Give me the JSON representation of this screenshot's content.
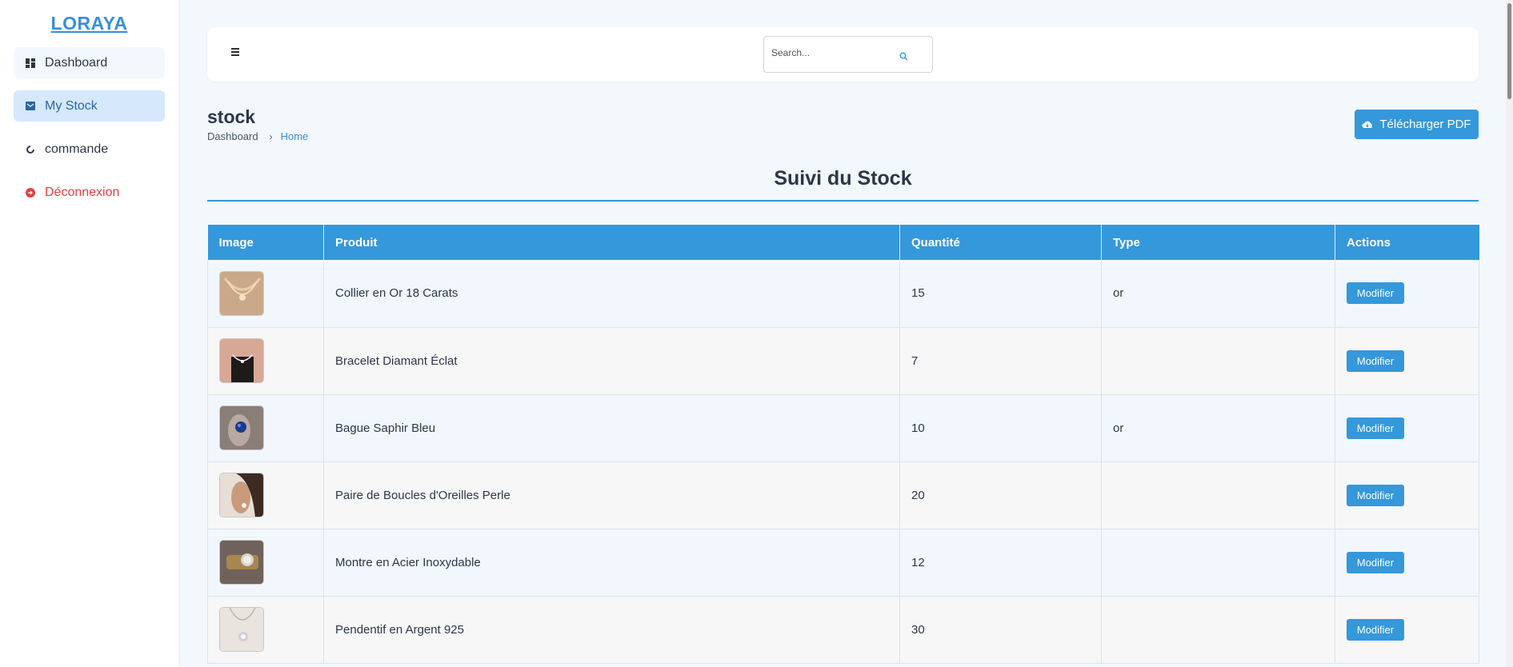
{
  "brand": "LORAYA",
  "sidebar": {
    "items": [
      {
        "label": "Dashboard",
        "icon": "dashboard-icon"
      },
      {
        "label": "My Stock",
        "icon": "stock-icon"
      },
      {
        "label": "commande",
        "icon": "loader-icon"
      },
      {
        "label": "Déconnexion",
        "icon": "logout-icon"
      }
    ]
  },
  "topbar": {
    "search_placeholder": "Search..."
  },
  "page": {
    "title": "stock",
    "breadcrumb": [
      "Dashboard",
      "Home"
    ],
    "pdf_button": "Télécharger PDF",
    "section_title": "Suivi du Stock"
  },
  "table": {
    "headers": [
      "Image",
      "Produit",
      "Quantité",
      "Type",
      "Actions"
    ],
    "rows": [
      {
        "product": "Collier en Or 18 Carats",
        "quantity": "15",
        "type": "or",
        "action": "Modifier"
      },
      {
        "product": "Bracelet Diamant Éclat",
        "quantity": "7",
        "type": "",
        "action": "Modifier"
      },
      {
        "product": "Bague Saphir Bleu",
        "quantity": "10",
        "type": "or",
        "action": "Modifier"
      },
      {
        "product": "Paire de Boucles d'Oreilles Perle",
        "quantity": "20",
        "type": "",
        "action": "Modifier"
      },
      {
        "product": "Montre en Acier Inoxydable",
        "quantity": "12",
        "type": "",
        "action": "Modifier"
      },
      {
        "product": "Pendentif en Argent 925",
        "quantity": "30",
        "type": "",
        "action": "Modifier"
      }
    ]
  },
  "colors": {
    "accent": "#3498db",
    "danger": "#e53e3e",
    "background": "#f3f8fd"
  }
}
